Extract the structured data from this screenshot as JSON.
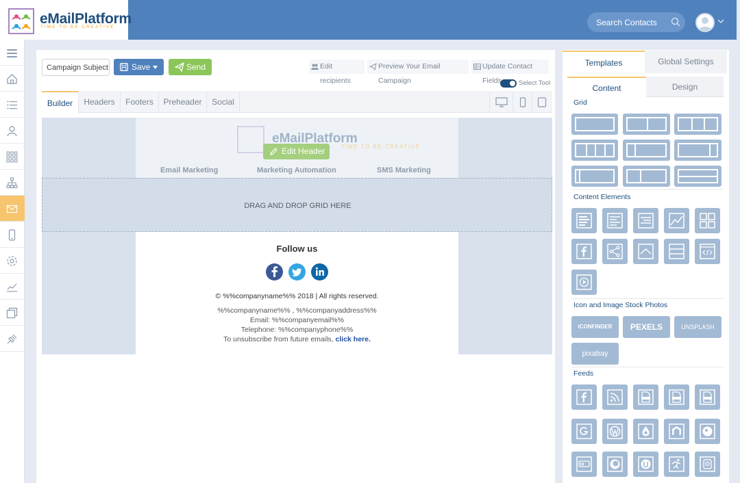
{
  "app": {
    "name": "eMailPlatform",
    "tagline": "TIME TO BE CREATIVE"
  },
  "topbar": {
    "search_placeholder": "Search Contacts"
  },
  "sidebar": {
    "items": [
      {
        "icon": "menu-icon"
      },
      {
        "icon": "home-icon"
      },
      {
        "icon": "list-icon"
      },
      {
        "icon": "contacts-icon"
      },
      {
        "icon": "apps-grid-icon"
      },
      {
        "icon": "sitemap-icon"
      },
      {
        "icon": "email-icon",
        "active": true
      },
      {
        "icon": "mobile-icon"
      },
      {
        "icon": "settings-icon"
      },
      {
        "icon": "stats-icon"
      },
      {
        "icon": "templates-icon"
      },
      {
        "icon": "integrations-icon"
      }
    ]
  },
  "toolbar": {
    "subject_value": "Campaign Subject",
    "save_label": "Save",
    "send_label": "Send",
    "edit_recipients": "Edit recipients",
    "preview": "Preview Your Email Campaign",
    "update_fields": "Update Contact Fields",
    "select_tool": "Select Tool"
  },
  "builder_tabs": [
    "Builder",
    "Headers",
    "Footers",
    "Preheader",
    "Social"
  ],
  "canvas": {
    "header_logo_name": "eMailPlatform",
    "header_logo_tag": "TIME TO BE CREATIVE",
    "edit_header": "Edit Header",
    "menu": [
      "Email Marketing",
      "Marketing Automation",
      "SMS Marketing"
    ],
    "drop_text": "DRAG AND DROP GRID HERE",
    "footer": {
      "follow_us": "Follow us",
      "copyright": "© %%companyname%% 2018   |   All rights reserved.",
      "address": "%%companyname%% , %%companyaddress%%",
      "email": "Email: %%companyemail%%",
      "telephone": "Telephone: %%companyphone%%",
      "unsubscribe": "To unsubscribe from future emails,",
      "unsubscribe_link": "click here."
    }
  },
  "right_panel": {
    "tabs": [
      "Templates",
      "Global Settings"
    ],
    "subtabs": [
      "Content",
      "Design"
    ],
    "sections": {
      "grid": "Grid",
      "content_elements": "Content Elements",
      "stock": "Icon and Image Stock Photos",
      "feeds": "Feeds"
    },
    "stock_items": [
      "ICONFINDER",
      "PEXELS",
      "UNSPLASH",
      "pixabay"
    ]
  },
  "colors": {
    "brand_blue": "#4f81bd",
    "accent": "#f7c56e",
    "send_green": "#8cc65b",
    "tile": "#a3bad4"
  }
}
